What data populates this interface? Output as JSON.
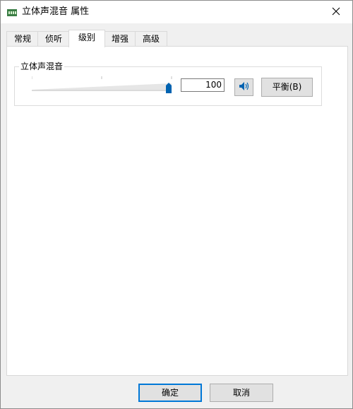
{
  "window": {
    "title": "立体声混音 属性"
  },
  "tabs": [
    {
      "label": "常规",
      "active": false
    },
    {
      "label": "侦听",
      "active": false
    },
    {
      "label": "级别",
      "active": true
    },
    {
      "label": "增强",
      "active": false
    },
    {
      "label": "高级",
      "active": false
    }
  ],
  "levels": {
    "group_label": "立体声混音",
    "volume_value": "100",
    "volume_level": 1.0,
    "balance_label": "平衡(B)",
    "speaker_icon": "speaker-icon"
  },
  "footer": {
    "ok_label": "确定",
    "cancel_label": "取消"
  },
  "colors": {
    "accent": "#0078d7",
    "slider_thumb": "#0063b1",
    "panel": "#ffffff"
  }
}
